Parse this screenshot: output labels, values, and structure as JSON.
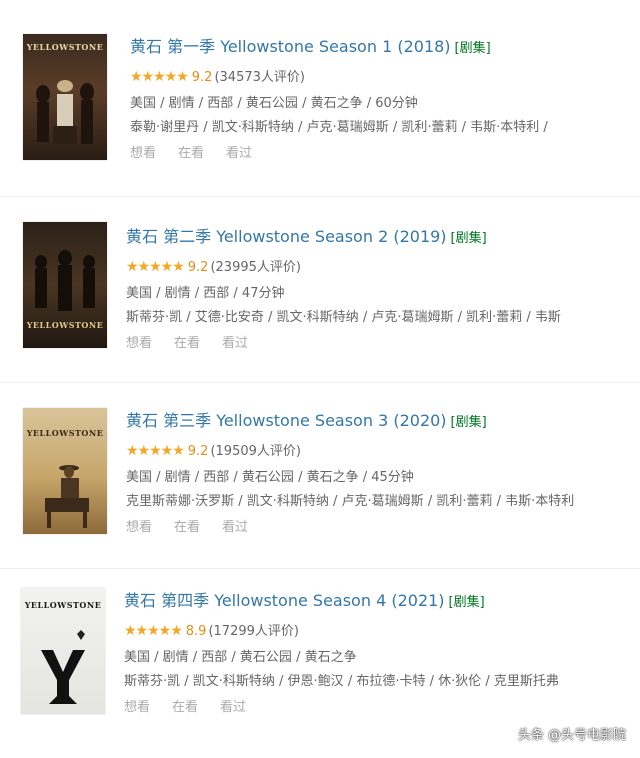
{
  "entries": [
    {
      "title_cn": "黄石 第一季",
      "title_en": "Yellowstone Season 1",
      "year": "(2018)",
      "playable": "[剧集]",
      "stars": "★★★★★",
      "score": "9.2",
      "votes": "(34573人评价)",
      "meta": "美国 / 剧情 / 西部 / 黄石公园 / 黄石之争 / 60分钟",
      "cast": "泰勒·谢里丹 / 凯文·科斯特纳 / 卢克·葛瑞姆斯 / 凯利·蕾莉 / 韦斯·本特利 /",
      "actions": [
        "想看",
        "在看",
        "看过"
      ],
      "poster_title": "YELLOWSTONE"
    },
    {
      "title_cn": "黄石 第二季",
      "title_en": "Yellowstone Season 2",
      "year": "(2019)",
      "playable": "[剧集]",
      "stars": "★★★★★",
      "score": "9.2",
      "votes": "(23995人评价)",
      "meta": "美国 / 剧情 / 西部 / 47分钟",
      "cast": "斯蒂芬·凯 / 艾德·比安奇 / 凯文·科斯特纳 / 卢克·葛瑞姆斯 / 凯利·蕾莉 / 韦斯",
      "actions": [
        "想看",
        "在看",
        "看过"
      ],
      "poster_title": "YELLOWSTONE"
    },
    {
      "title_cn": "黄石 第三季",
      "title_en": "Yellowstone Season 3",
      "year": "(2020)",
      "playable": "[剧集]",
      "stars": "★★★★★",
      "score": "9.2",
      "votes": "(19509人评价)",
      "meta": "美国 / 剧情 / 西部 / 黄石公园 / 黄石之争 / 45分钟",
      "cast": "克里斯蒂娜·沃罗斯 / 凯文·科斯特纳 / 卢克·葛瑞姆斯 / 凯利·蕾莉 / 韦斯·本特利",
      "actions": [
        "想看",
        "在看",
        "看过"
      ],
      "poster_title": "YELLOWSTONE"
    },
    {
      "title_cn": "黄石 第四季",
      "title_en": "Yellowstone Season 4",
      "year": "(2021)",
      "playable": "[剧集]",
      "stars": "★★★★★",
      "score": "8.9",
      "votes": "(17299人评价)",
      "meta": "美国 / 剧情 / 西部 / 黄石公园 / 黄石之争",
      "cast": "斯蒂芬·凯 / 凯文·科斯特纳 / 伊恩·鲍汉 / 布拉德·卡特 / 休·狄伦 / 克里斯托弗",
      "actions": [
        "想看",
        "在看",
        "看过"
      ],
      "poster_title": "YELLOWSTONE"
    }
  ],
  "watermark": "头条 @头号电影院",
  "colors": {
    "title": "#3377aa",
    "playable": "#007722",
    "star": "#f5a623",
    "meta": "#666666",
    "actions": "#aaaaaa"
  }
}
